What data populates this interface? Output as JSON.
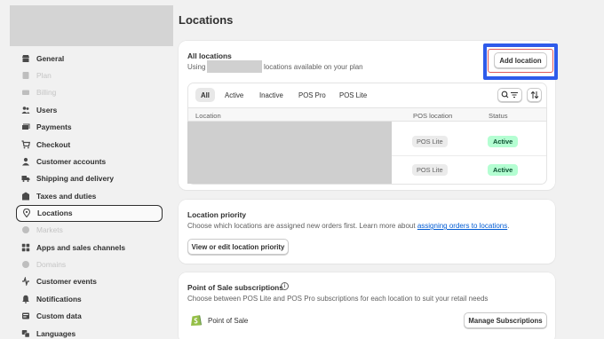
{
  "sidebar": {
    "items": [
      {
        "label": "General",
        "icon": "store-icon",
        "disabled": false
      },
      {
        "label": "Plan",
        "icon": "plan-icon",
        "disabled": true
      },
      {
        "label": "Billing",
        "icon": "billing-icon",
        "disabled": true
      },
      {
        "label": "Users",
        "icon": "users-icon",
        "disabled": false
      },
      {
        "label": "Payments",
        "icon": "payments-icon",
        "disabled": false
      },
      {
        "label": "Checkout",
        "icon": "cart-icon",
        "disabled": false
      },
      {
        "label": "Customer accounts",
        "icon": "person-icon",
        "disabled": false
      },
      {
        "label": "Shipping and delivery",
        "icon": "truck-icon",
        "disabled": false
      },
      {
        "label": "Taxes and duties",
        "icon": "tax-icon",
        "disabled": false
      },
      {
        "label": "Locations",
        "icon": "location-icon",
        "disabled": false,
        "active": true
      },
      {
        "label": "Markets",
        "icon": "globe-icon",
        "disabled": true
      },
      {
        "label": "Apps and sales channels",
        "icon": "apps-icon",
        "disabled": false
      },
      {
        "label": "Domains",
        "icon": "globe-icon",
        "disabled": true
      },
      {
        "label": "Customer events",
        "icon": "events-icon",
        "disabled": false
      },
      {
        "label": "Notifications",
        "icon": "bell-icon",
        "disabled": false
      },
      {
        "label": "Custom data",
        "icon": "data-icon",
        "disabled": false
      },
      {
        "label": "Languages",
        "icon": "language-icon",
        "disabled": false
      }
    ]
  },
  "page": {
    "title": "Locations"
  },
  "all_locations": {
    "title": "All locations",
    "sub_prefix": "Using",
    "sub_suffix": "locations available on your plan",
    "add_button": "Add location",
    "tabs": [
      "All",
      "Active",
      "Inactive",
      "POS Pro",
      "POS Lite"
    ],
    "columns": [
      "Location",
      "POS location",
      "Status"
    ],
    "rows": [
      {
        "pos": "POS Lite",
        "status": "Active"
      },
      {
        "pos": "POS Lite",
        "status": "Active"
      }
    ]
  },
  "priority": {
    "title": "Location priority",
    "desc": "Choose which locations are assigned new orders first. Learn more about",
    "link": "assigning orders to locations",
    "period": ".",
    "button": "View or edit location priority"
  },
  "pos_subs": {
    "title": "Point of Sale subscriptions",
    "desc": "Choose between POS Lite and POS Pro subscriptions for each location to suit your retail needs",
    "app_name": "Point of Sale",
    "button": "Manage Subscriptions"
  },
  "colors": {
    "accent_highlight": "#2f5bea",
    "active_badge_bg": "#b4fed2",
    "link": "#005bd3"
  }
}
